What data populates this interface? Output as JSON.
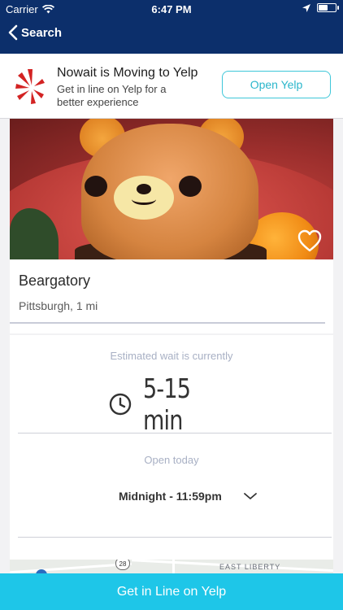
{
  "status_bar": {
    "carrier": "Carrier",
    "time": "6:47 PM",
    "battery_level": 0.6,
    "icons": [
      "wifi-icon",
      "location-arrow-icon",
      "battery-icon"
    ]
  },
  "nav": {
    "back_label": "Search"
  },
  "banner": {
    "title": "Nowait is Moving to Yelp",
    "subtitle": "Get in line on Yelp for a better experience",
    "button_label": "Open Yelp",
    "logo": "yelp-burst-logo",
    "button_color": "#2ab6cb"
  },
  "restaurant": {
    "name": "Beargatory",
    "location": "Pittsburgh, 1 mi",
    "favorite_icon": "heart-outline-icon"
  },
  "wait": {
    "label": "Estimated wait is currently",
    "value": "5-15 min",
    "icon": "clock-icon"
  },
  "hours": {
    "label": "Open today",
    "value": "Midnight - 11:59pm",
    "expand_icon": "chevron-down-icon"
  },
  "map": {
    "route_shield": "28",
    "district": "EAST LIBERTY"
  },
  "cta": {
    "label": "Get in Line on Yelp",
    "color": "#1ec6e8"
  },
  "colors": {
    "nav_bg": "#0c2f6b",
    "yelp_red": "#d32323",
    "muted_text": "#a8b0c4"
  }
}
